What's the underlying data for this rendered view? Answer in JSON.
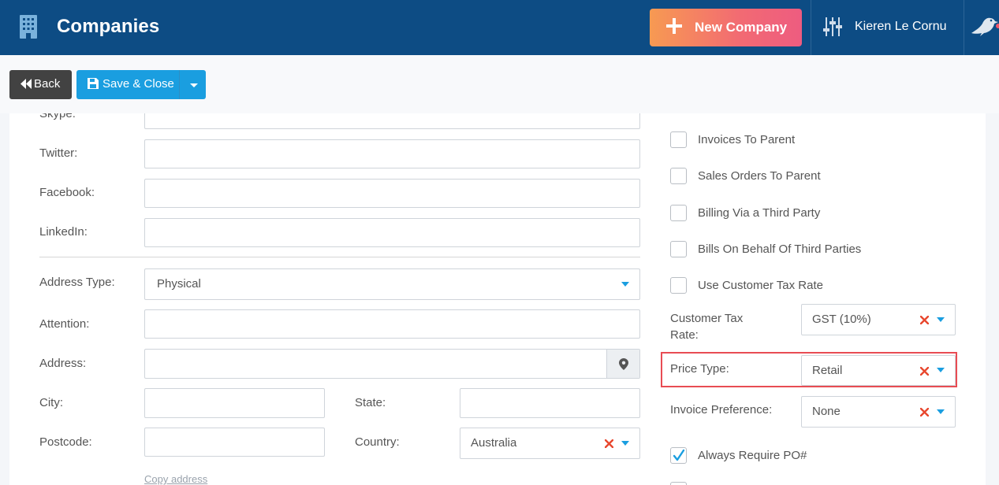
{
  "header": {
    "title": "Companies",
    "new_button_label": "New Company",
    "user_name": "Kieren Le Cornu",
    "icons": [
      "building-icon",
      "plus-icon",
      "settings-sliders-icon",
      "bird-icon"
    ],
    "brand_color": "#0d4c84"
  },
  "toolbar": {
    "back_label": "Back",
    "save_close_label": "Save & Close"
  },
  "form_left": {
    "skype_label": "Skype:",
    "twitter_label": "Twitter:",
    "facebook_label": "Facebook:",
    "linkedin_label": "LinkedIn:",
    "address_type_label": "Address Type:",
    "address_type_value": "Physical",
    "attention_label": "Attention:",
    "address_label": "Address:",
    "city_label": "City:",
    "state_label": "State:",
    "postcode_label": "Postcode:",
    "country_label": "Country:",
    "country_value": "Australia",
    "copy_address_link": "Copy address"
  },
  "form_right": {
    "checkboxes": [
      {
        "label": "Invoices To Parent",
        "checked": false
      },
      {
        "label": "Sales Orders To Parent",
        "checked": false
      },
      {
        "label": "Billing Via a Third Party",
        "checked": false
      },
      {
        "label": "Bills On Behalf Of Third Parties",
        "checked": false
      },
      {
        "label": "Use Customer Tax Rate",
        "checked": false
      }
    ],
    "customer_tax_rate_label_line1": "Customer Tax",
    "customer_tax_rate_label_line2": "Rate:",
    "customer_tax_rate_value": "GST (10%)",
    "price_type_label": "Price Type:",
    "price_type_value": "Retail",
    "invoice_preference_label": "Invoice Preference:",
    "invoice_preference_value": "None",
    "always_require_po": {
      "label": "Always Require PO#",
      "checked": true
    }
  },
  "colors": {
    "accent_blue": "#1a9ee0",
    "clear_red": "#e8472e",
    "highlight_red": "#e84c53"
  }
}
